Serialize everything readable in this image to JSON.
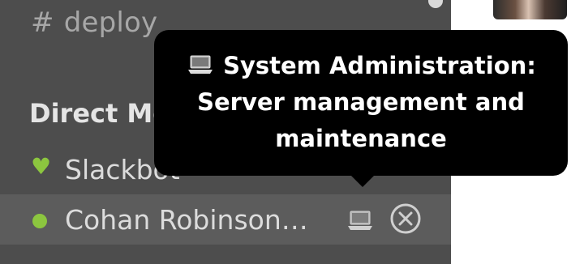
{
  "sidebar": {
    "channel": {
      "hash": "#",
      "name": "deploy"
    },
    "section_title": "Direct Me",
    "direct_messages": [
      {
        "name": "Slackbot",
        "presence": "heart-icon",
        "status_color": "#8cc63f"
      },
      {
        "name": "Cohan Robinson…",
        "presence": "green-dot",
        "status_icon": "laptop-icon",
        "action_icon": "close-icon",
        "status_color": "#8cc63f"
      }
    ]
  },
  "tooltip": {
    "icon": "laptop-icon",
    "lines": [
      "System Administration:",
      "Server management and",
      "maintenance"
    ]
  },
  "colors": {
    "sidebar": "#4d4d4d",
    "selected_row": "#5c5c5c",
    "online": "#8cc63f",
    "tooltip": "#000000",
    "page": "#ffffff"
  }
}
